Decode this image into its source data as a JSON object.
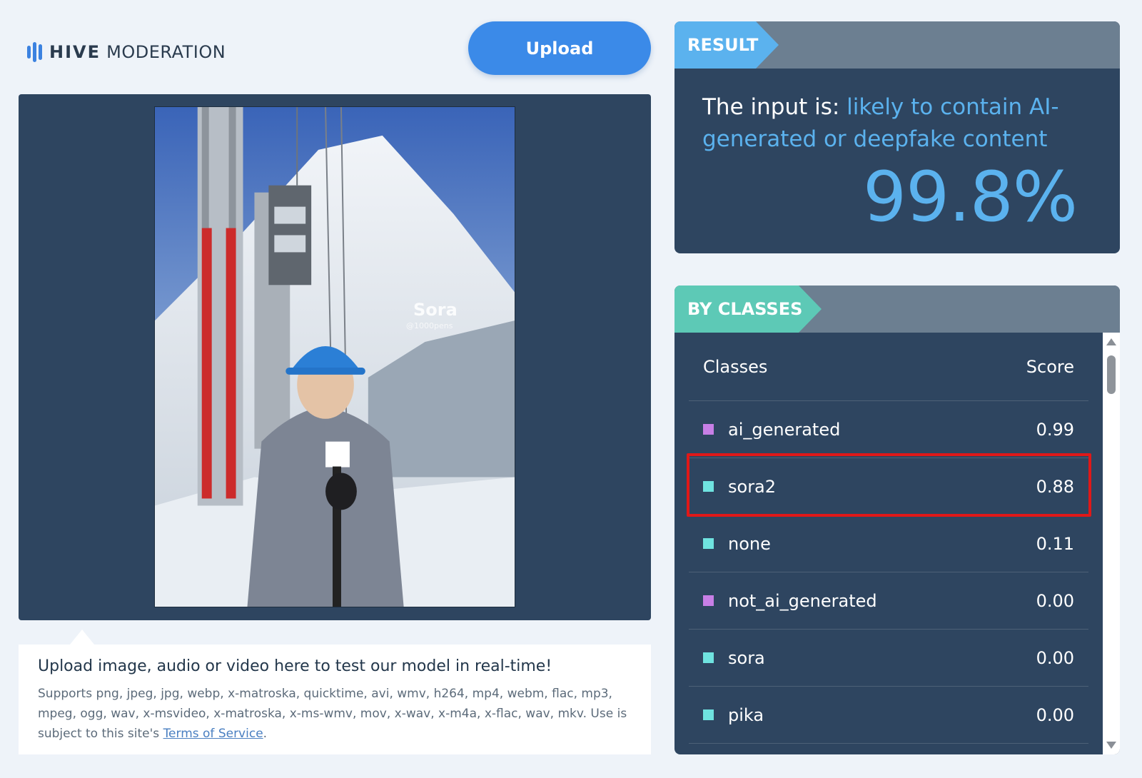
{
  "logo": {
    "brand_bold": "HIVE",
    "brand_rest": "MODERATION",
    "icon": "hive-bars-icon"
  },
  "upload": {
    "label": "Upload"
  },
  "preview": {
    "watermark": "Sora",
    "watermark_handle": "@1000pens"
  },
  "info": {
    "title": "Upload image, audio or video here to test our model in real-time!",
    "description": "Supports png, jpeg, jpg, webp, x-matroska, quicktime, avi, wmv, h264, mp4, webm, flac, mp3, mpeg, ogg, wav, x-msvideo, x-matroska, x-ms-wmv, mov, x-wav, x-m4a, x-flac, wav, mkv. Use is subject to this site's ",
    "link_text": "Terms of Service",
    "end": "."
  },
  "result": {
    "tag": "RESULT",
    "prefix": "The input is: ",
    "verdict": "likely to contain AI-generated or deepfake content",
    "percent": "99.8%"
  },
  "classes": {
    "tag": "BY CLASSES",
    "col_class": "Classes",
    "col_score": "Score",
    "rows": [
      {
        "name": "ai_generated",
        "score": "0.99",
        "color": "#c77fe6"
      },
      {
        "name": "sora2",
        "score": "0.88",
        "color": "#6fe3e0"
      },
      {
        "name": "none",
        "score": "0.11",
        "color": "#6fe3e0"
      },
      {
        "name": "not_ai_generated",
        "score": "0.00",
        "color": "#c77fe6"
      },
      {
        "name": "sora",
        "score": "0.00",
        "color": "#6fe3e0"
      },
      {
        "name": "pika",
        "score": "0.00",
        "color": "#6fe3e0"
      }
    ]
  },
  "colors": {
    "accent_blue": "#3b8ae8",
    "panel_navy": "#2e4560",
    "result_blue": "#5bb2ee",
    "classes_teal": "#5dc9b6",
    "highlight_red": "#e01818"
  }
}
